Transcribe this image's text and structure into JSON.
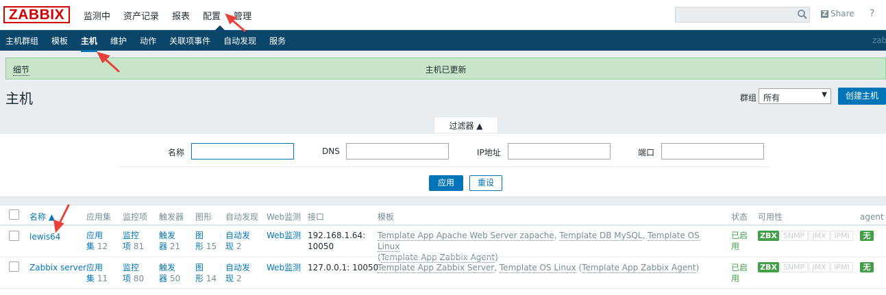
{
  "header": {
    "logo": "ZABBIX",
    "nav": [
      "监测中",
      "资产记录",
      "报表",
      "配置",
      "管理"
    ],
    "share_label": "Share",
    "help_label": "?"
  },
  "subnav": {
    "items": [
      "主机群组",
      "模板",
      "主机",
      "维护",
      "动作",
      "关联项事件",
      "自动发现",
      "服务"
    ],
    "right_text": "zab"
  },
  "message": {
    "details": "细节",
    "title": "主机已更新"
  },
  "page": {
    "title": "主机",
    "group_label": "群组",
    "group_value": "所有",
    "create_button": "创建主机"
  },
  "filter": {
    "tab_label": "过滤器 ▲",
    "name_label": "名称",
    "dns_label": "DNS",
    "ip_label": "IP地址",
    "port_label": "端口",
    "apply": "应用",
    "reset": "重设"
  },
  "table": {
    "headers": {
      "name": "名称 ▲",
      "apps": "应用集",
      "items": "监控项",
      "triggers": "触发器",
      "graphs": "图形",
      "discovery": "自动发现",
      "web": "Web监测",
      "interface": "接口",
      "templates": "模板",
      "status": "状态",
      "availability": "可用性",
      "agent": "agent 加"
    },
    "rows": [
      {
        "name": "lewis64",
        "apps_a": "应用",
        "apps_b": "集",
        "apps_count": "12",
        "items_a": "监控",
        "items_b": "项",
        "items_count": "81",
        "triggers_a": "触发",
        "triggers_b": "器",
        "triggers_count": "21",
        "graphs_a": "图",
        "graphs_b": "形",
        "graphs_count": "15",
        "disc_a": "自动发",
        "disc_b": "现",
        "disc_count": "2",
        "web": "Web监测",
        "iface_a": "192.168.1.64:",
        "iface_b": "10050",
        "t1": "Template App Apache Web Server zapache",
        "t2": "Template DB MySQL",
        "t3": "Template OS Linux",
        "t_paren": "Template App Zabbix Agent",
        "status_a": "已启",
        "status_b": "用",
        "zbx": "ZBX",
        "snmp": "SNMP",
        "jmx": "JMX",
        "ipmi": "IPMI",
        "enc": "无"
      },
      {
        "name": "Zabbix server",
        "apps_a": "应用",
        "apps_b": "集",
        "apps_count": "11",
        "items_a": "监控",
        "items_b": "项",
        "items_count": "80",
        "triggers_a": "触发",
        "triggers_b": "器",
        "triggers_count": "50",
        "graphs_a": "图",
        "graphs_b": "形",
        "graphs_count": "14",
        "disc_a": "自动发",
        "disc_b": "现",
        "disc_count": "2",
        "web": "Web监测",
        "iface": "127.0.0.1: 10050",
        "t1": "Template App Zabbix Server",
        "t2": "Template OS Linux",
        "t_paren": "Template App Zabbix Agent",
        "status_a": "已启",
        "status_b": "用",
        "zbx": "ZBX",
        "snmp": "SNMP",
        "jmx": "JMX",
        "ipmi": "IPMI",
        "enc": "无"
      }
    ]
  },
  "colors": {
    "brand_red": "#d40000",
    "nav_blue": "#0a466a",
    "link_blue": "#0275b8",
    "success_green": "#429e47",
    "message_bg": "#c8e6c9"
  }
}
